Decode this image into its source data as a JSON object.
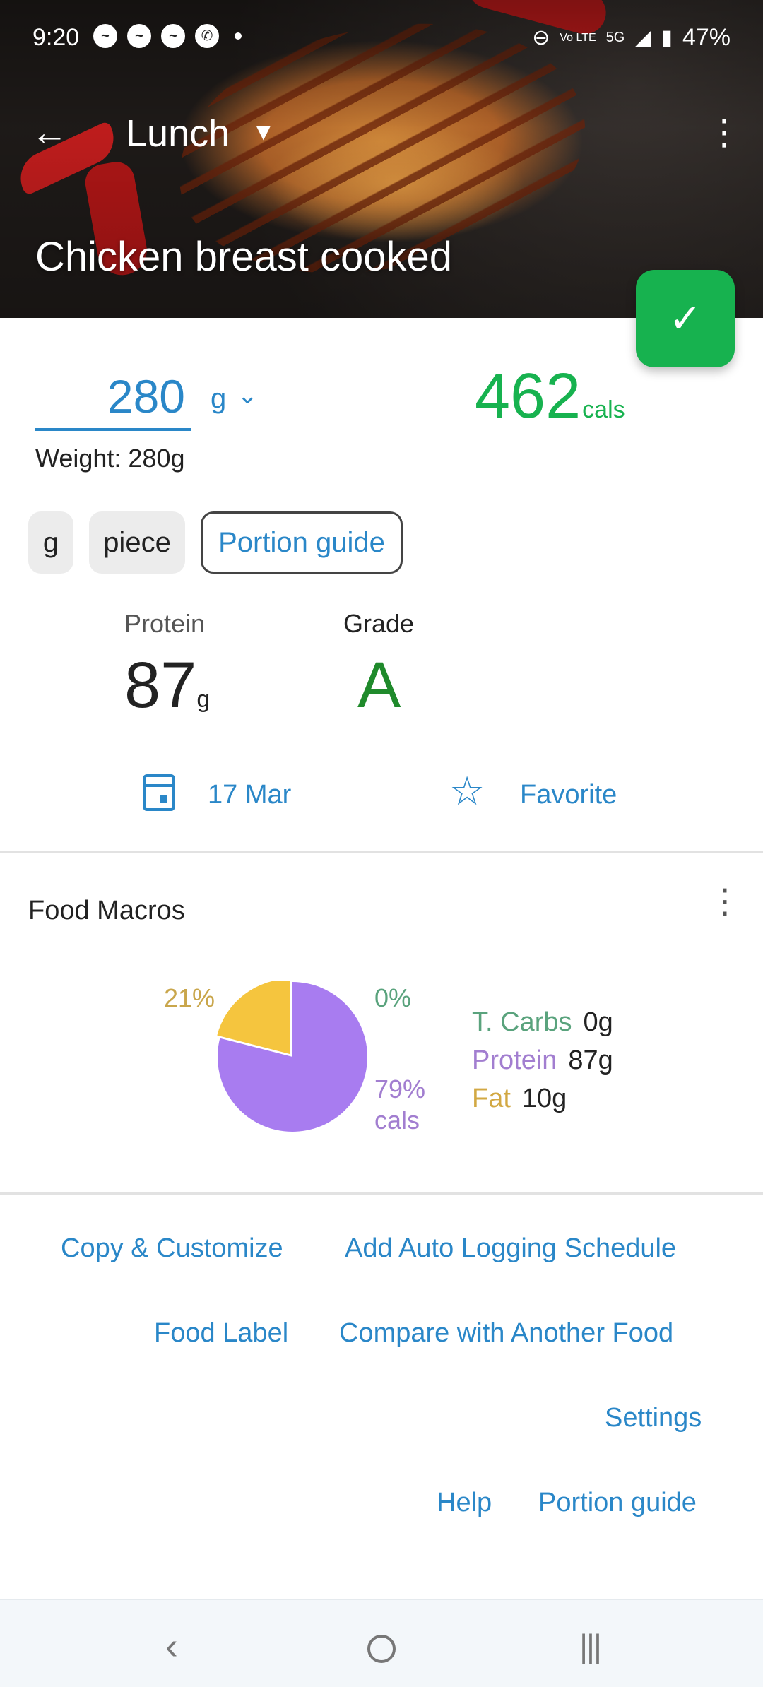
{
  "status_bar": {
    "time": "9:20",
    "notifications": [
      "messenger-icon",
      "messenger-icon",
      "messenger-icon",
      "whatsapp-icon"
    ],
    "volte": "Vo LTE",
    "network": "5G",
    "battery": "47%"
  },
  "app_bar": {
    "meal": "Lunch"
  },
  "food": {
    "name": "Chicken breast cooked"
  },
  "quantity": {
    "value": "280",
    "unit": "g",
    "weight_label": "Weight: 280g"
  },
  "calories": {
    "value": "462",
    "unit": "cals"
  },
  "unit_chips": [
    "g",
    "piece",
    "Portion guide"
  ],
  "stats": {
    "protein_label": "Protein",
    "protein_value": "87",
    "protein_unit": "g",
    "grade_label": "Grade",
    "grade_value": "A"
  },
  "actions": {
    "date": "17 Mar",
    "favorite": "Favorite"
  },
  "macros": {
    "title": "Food Macros",
    "pct_fat": "21%",
    "pct_carbs": "0%",
    "pct_protein": "79%",
    "pct_protein_unit": "cals",
    "legend": [
      {
        "name": "T. Carbs",
        "value": "0g"
      },
      {
        "name": "Protein",
        "value": "87g"
      },
      {
        "name": "Fat",
        "value": "10g"
      }
    ],
    "colors": {
      "carbs": "#5aa37d",
      "protein": "#a87cf0",
      "fat": "#f5c53e"
    },
    "fractions": {
      "carbs": 0.0,
      "protein": 0.79,
      "fat": 0.21
    }
  },
  "links": {
    "copy": "Copy & Customize",
    "auto": "Add Auto Logging Schedule",
    "label": "Food Label",
    "compare": "Compare with Another Food",
    "settings": "Settings",
    "help": "Help",
    "portion": "Portion guide"
  },
  "colors": {
    "accent": "#2a87c8",
    "calories": "#17b24f",
    "grade": "#1f8a2b"
  }
}
